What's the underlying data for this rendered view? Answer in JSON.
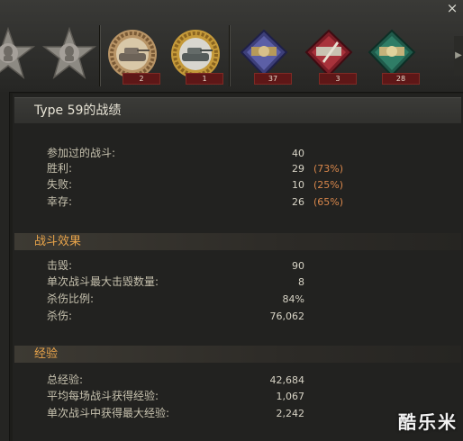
{
  "window": {
    "close_glyph": "×"
  },
  "medals": [
    {
      "name": "soldier-face-star-medal",
      "count": ""
    },
    {
      "name": "soldier-face-star-medal-2",
      "count": ""
    },
    {
      "name": "tank-wreath-medal",
      "count": "2"
    },
    {
      "name": "tank-wreath-medal-gold",
      "count": "1"
    },
    {
      "name": "ribbon-badge-blue",
      "count": "37"
    },
    {
      "name": "ribbon-badge-red",
      "count": "3"
    },
    {
      "name": "ribbon-badge-green",
      "count": "28"
    }
  ],
  "panel": {
    "title": "Type 59的战绩"
  },
  "battles": [
    {
      "label": "参加过的战斗:",
      "value": "40",
      "pct": ""
    },
    {
      "label": "胜利:",
      "value": "29",
      "pct": "(73%)"
    },
    {
      "label": "失败:",
      "value": "10",
      "pct": "(25%)"
    },
    {
      "label": "幸存:",
      "value": "26",
      "pct": "(65%)"
    }
  ],
  "effect": {
    "title": "战斗效果",
    "rows": [
      {
        "label": "击毁:",
        "value": "90"
      },
      {
        "label": "单次战斗最大击毁数量:",
        "value": "8"
      },
      {
        "label": "杀伤比例:",
        "value": "84%"
      },
      {
        "label": "杀伤:",
        "value": "76,062"
      }
    ]
  },
  "experience": {
    "title": "经验",
    "rows": [
      {
        "label": "总经验:",
        "value": "42,684"
      },
      {
        "label": "平均每场战斗获得经验:",
        "value": "1,067"
      },
      {
        "label": "单次战斗中获得最大经验:",
        "value": "2,242"
      }
    ]
  },
  "watermark": "酷乐米",
  "colors": {
    "accent_orange": "#e7a34a",
    "percent": "#d9874b",
    "count_badge": "#5e1717"
  }
}
